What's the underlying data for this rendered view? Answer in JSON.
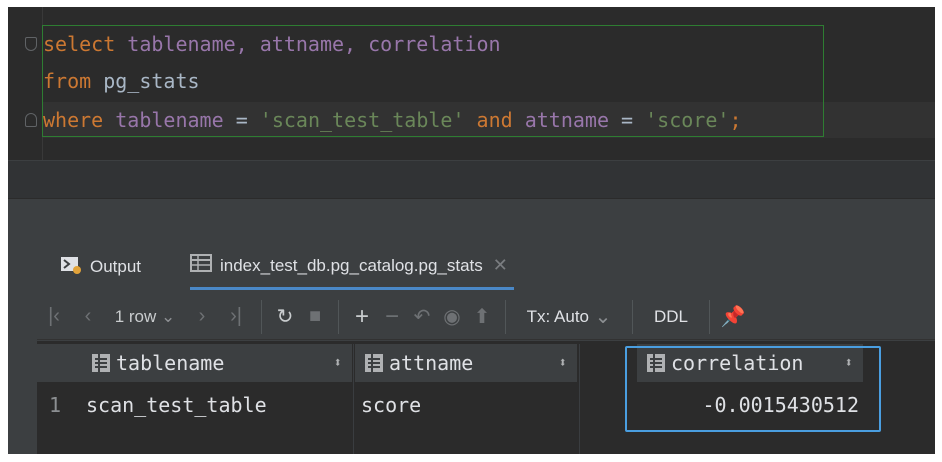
{
  "editor": {
    "line1": {
      "kw": "select",
      "cols": "tablename, attname, correlation"
    },
    "line2": {
      "kw": "from",
      "table": "pg_stats"
    },
    "line3": {
      "kw": "where",
      "col1": "tablename",
      "eq1": "=",
      "val1": "'scan_test_table'",
      "and": "and",
      "col2": "attname",
      "eq2": "=",
      "val2": "'score'",
      "semi": ";"
    }
  },
  "tabs": [
    {
      "label": "Output",
      "icon": "console-icon"
    },
    {
      "label": "index_test_db.pg_catalog.pg_stats",
      "icon": "table-icon",
      "active": true
    }
  ],
  "toolbar": {
    "row_count": "1 row",
    "tx_mode": "Tx: Auto",
    "ddl": "DDL"
  },
  "grid": {
    "columns": [
      "tablename",
      "attname",
      "correlation"
    ],
    "rows": [
      {
        "num": "1",
        "tablename": "scan_test_table",
        "attname": "score",
        "correlation": "-0.0015430512"
      }
    ]
  },
  "colors": {
    "editor_bg": "#2b2b2b",
    "keyword": "#cc7832",
    "identifier": "#9876aa",
    "string": "#6a8759",
    "highlight": "#4a9ee0"
  }
}
